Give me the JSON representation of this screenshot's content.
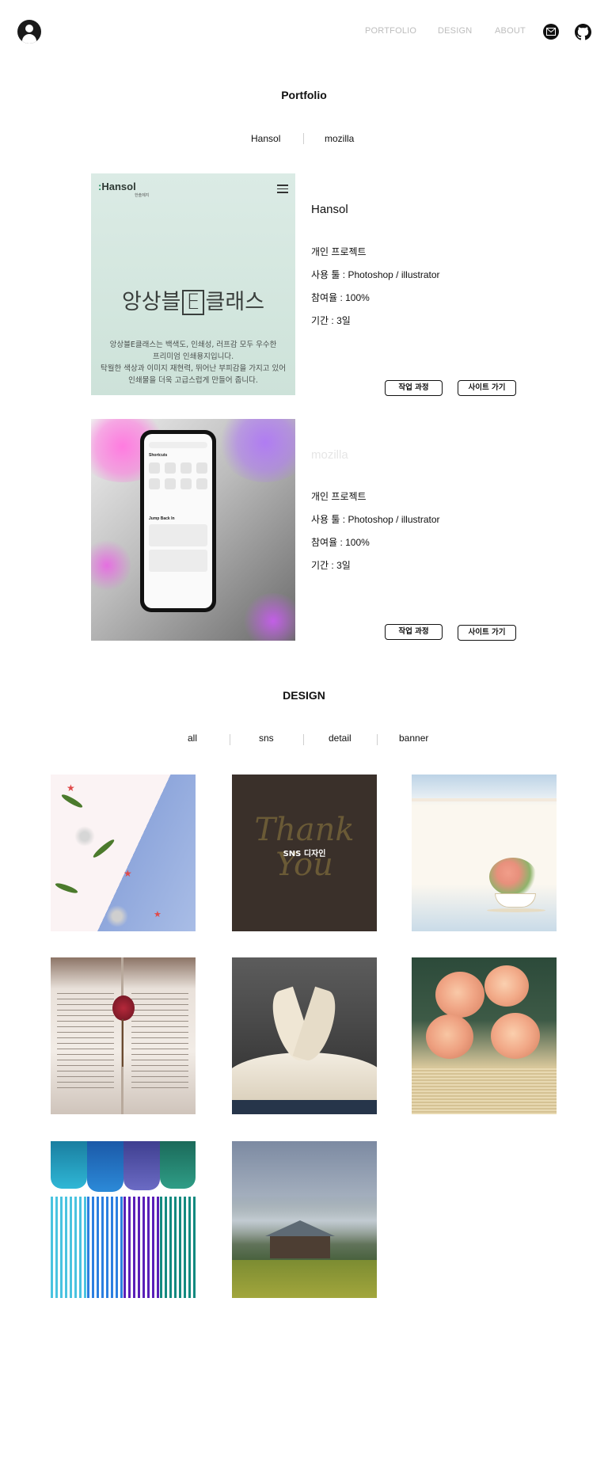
{
  "nav": {
    "portfolio": "PORTFOLIO",
    "design": "DESIGN",
    "about": "ABOUT"
  },
  "icons": {
    "avatar": "user-avatar-icon",
    "mail": "mail-icon",
    "github": "github-icon"
  },
  "portfolio": {
    "title": "Portfolio",
    "tabs": [
      "Hansol",
      "mozilla"
    ],
    "projects": [
      {
        "name": "Hansol",
        "type": "개인 프로젝트",
        "tools": "사용 툴 : Photoshop / illustrator",
        "share": "참여율 : 100%",
        "period": "기간 : 3일",
        "process_btn": "작업 과정",
        "site_btn": "사이트 가기",
        "thumb": {
          "logo": "Hansol",
          "logo_sub": "한솔제지",
          "headline_a": "앙상블",
          "headline_e": "E",
          "headline_b": "클래스",
          "desc": [
            "앙상블E클래스는 백색도, 인쇄성, 러프감 모두 우수한",
            "프리미엄 인쇄용지입니다.",
            "탁월한 색상과 이미지 재현력, 뛰어난 부피감을 가지고 있어",
            "인쇄물을 더욱 고급스럽게 만들어 줍니다."
          ]
        }
      },
      {
        "name": "mozilla",
        "type": "개인 프로젝트",
        "tools": "사용 툴 : Photoshop / illustrator",
        "share": "참여율 : 100%",
        "period": "기간 : 3일",
        "process_btn": "작업 과정",
        "site_btn": "사이트 가기",
        "thumb": {
          "shortcuts": "Shortcuts",
          "jump_back": "Jump Back In"
        }
      }
    ]
  },
  "design": {
    "title": "DESIGN",
    "tabs": [
      "all",
      "sns",
      "detail",
      "banner"
    ],
    "tiles": [
      {
        "name": "christmas-pattern"
      },
      {
        "name": "thank-you-card",
        "overlay": "SNS 디자인",
        "script_top": "Thank",
        "script_bottom": "You"
      },
      {
        "name": "watercolor-teacup"
      },
      {
        "name": "book-with-rose"
      },
      {
        "name": "heart-book"
      },
      {
        "name": "roses-on-book"
      },
      {
        "name": "chalk-pastels"
      },
      {
        "name": "foggy-cabin"
      }
    ]
  },
  "colors": {
    "nav_text": "#bdbdbd",
    "hansol_bg": "#d7e8e1",
    "faded_title": "#e6e6e6",
    "design_dark": "#3a302a"
  }
}
